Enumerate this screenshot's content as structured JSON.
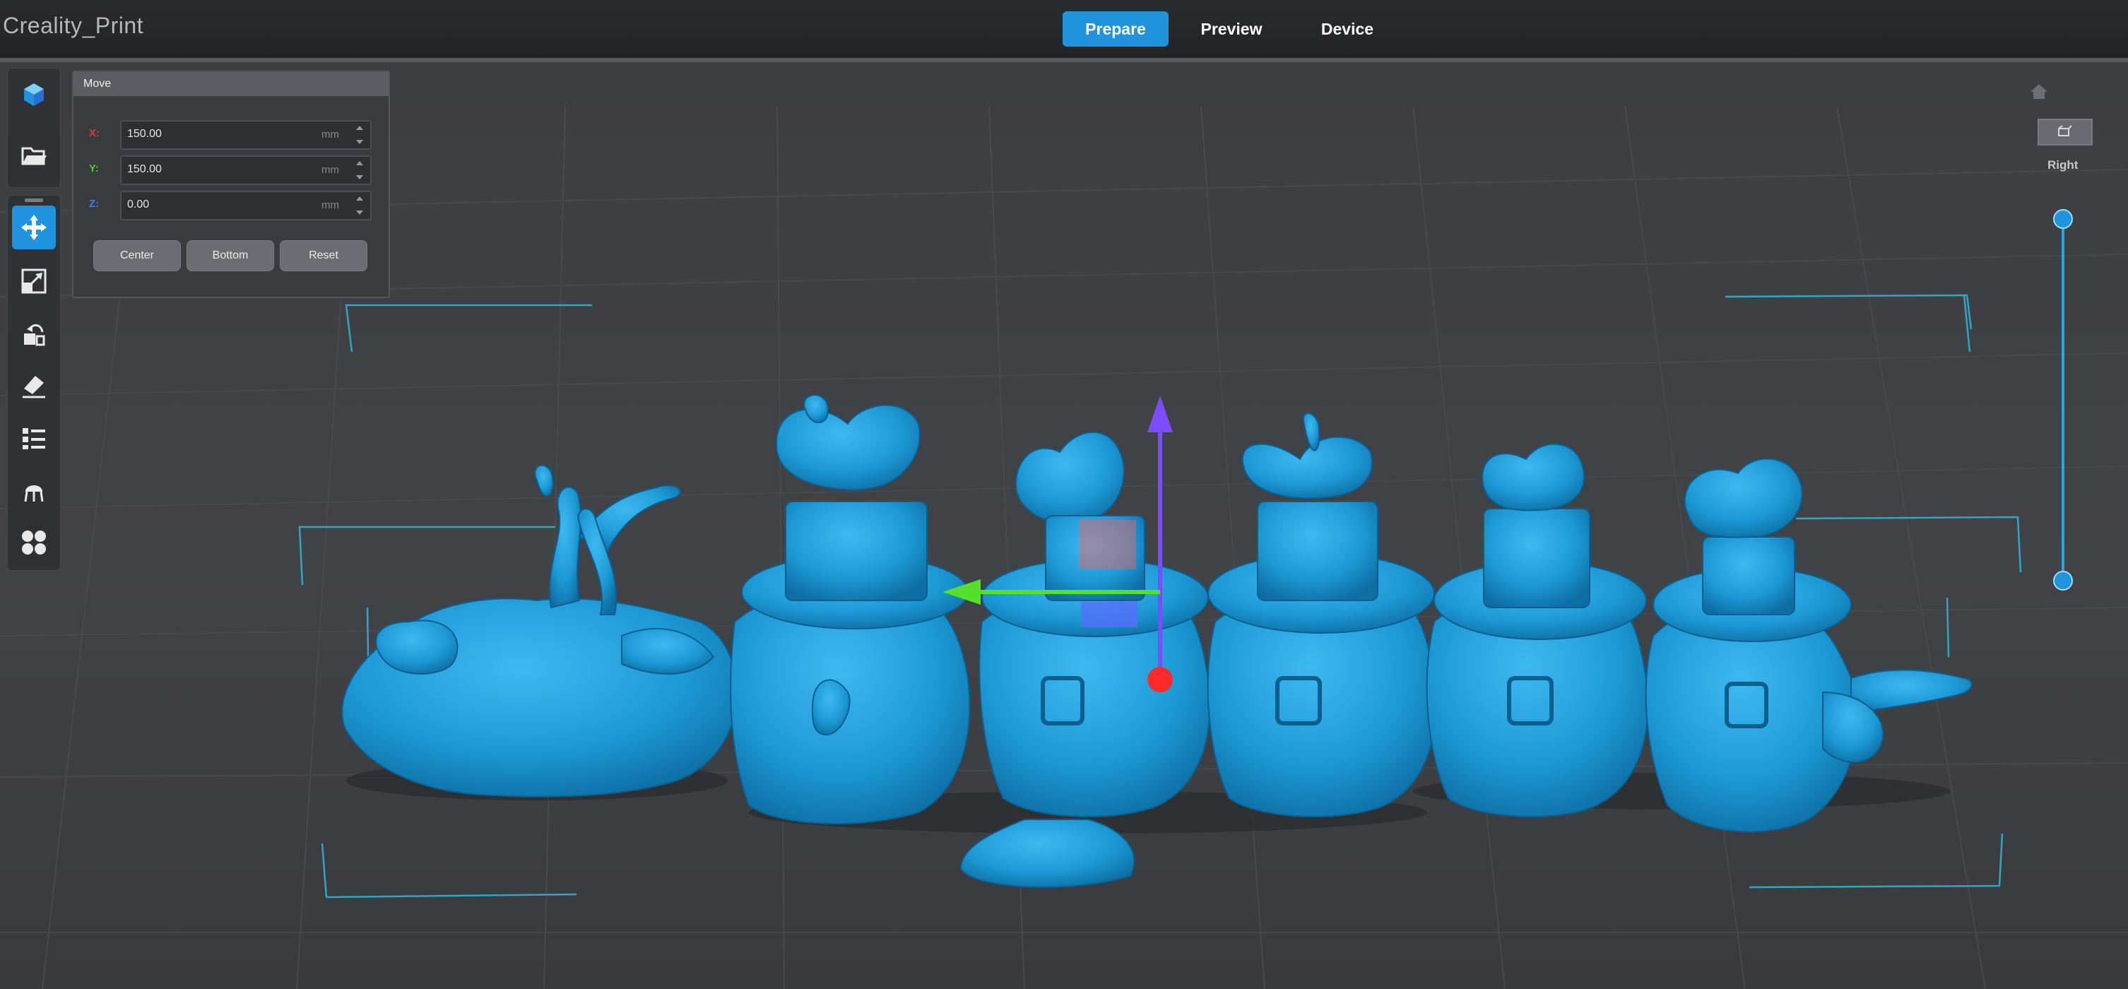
{
  "app": {
    "title": "Creality_Print"
  },
  "tabs": [
    {
      "label": "Prepare",
      "active": true
    },
    {
      "label": "Preview",
      "active": false
    },
    {
      "label": "Device",
      "active": false
    }
  ],
  "toolbar": {
    "top_icons": [
      "logo-icon",
      "open-folder-icon"
    ],
    "tools": [
      "move-icon",
      "scale-icon",
      "rotate-icon",
      "lay-flat-icon",
      "list-icon",
      "support-icon",
      "arrange-icon"
    ],
    "active_tool": "move-icon"
  },
  "move_panel": {
    "title": "Move",
    "x_label": "X:",
    "x_value": "150.00",
    "y_label": "Y:",
    "y_value": "150.00",
    "z_label": "Z:",
    "z_value": "0.00",
    "unit": "mm",
    "center_label": "Center",
    "bottom_label": "Bottom",
    "reset_label": "Reset"
  },
  "view_controls": {
    "home_icon": "home-icon",
    "view_cube_icon": "view-cube-icon",
    "current_view": "Right"
  },
  "colors": {
    "accent": "#1f93dd",
    "model": "#1d9ad6",
    "x_axis": "#ff2b2b",
    "y_axis": "#55e02a",
    "z_axis": "#7b4dff",
    "bed_outline": "#2fa7c4"
  }
}
